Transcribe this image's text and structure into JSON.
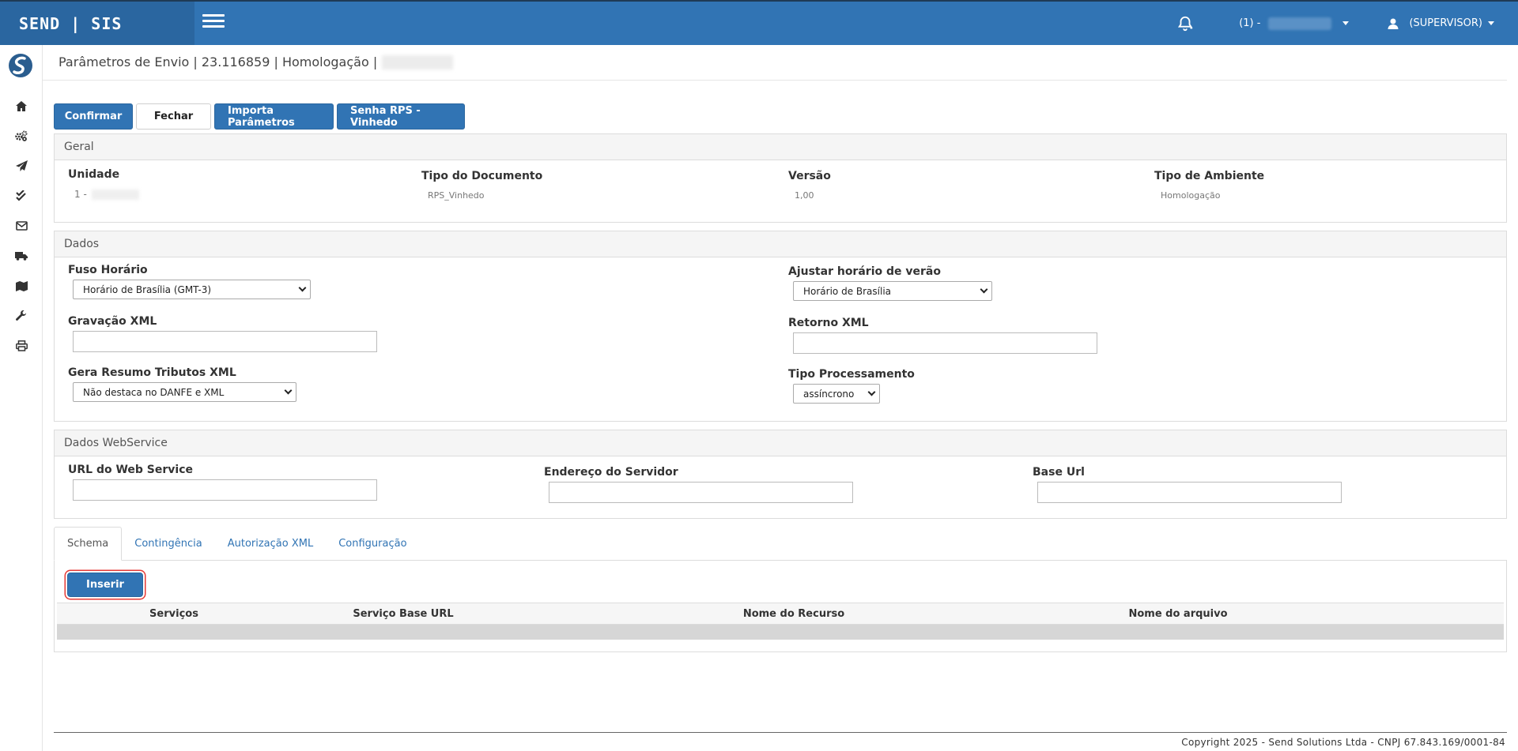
{
  "navbar": {
    "brand": "SEND | SIS",
    "company_label": "(1) -",
    "user_label": "(SUPERVISOR)"
  },
  "sidebar": {
    "items": [
      "home-icon",
      "cogs-icon",
      "paper-plane-icon",
      "check-double-icon",
      "envelope-icon",
      "truck-icon",
      "map-icon",
      "wrench-icon",
      "print-icon"
    ]
  },
  "page": {
    "title": "Parâmetros de Envio | 23.116859 | Homologação |"
  },
  "toolbar": {
    "confirm": "Confirmar",
    "close": "Fechar",
    "import": "Importa Parâmetros",
    "rps": "Senha RPS - Vinhedo"
  },
  "geral": {
    "heading": "Geral",
    "unidade_label": "Unidade",
    "unidade_value": "1 -",
    "tipo_doc_label": "Tipo do Documento",
    "tipo_doc_value": "RPS_Vinhedo",
    "versao_label": "Versão",
    "versao_value": "1,00",
    "ambiente_label": "Tipo de Ambiente",
    "ambiente_value": "Homologação"
  },
  "dados": {
    "heading": "Dados",
    "fuso_label": "Fuso Horário",
    "fuso_value": "Horário de Brasília (GMT-3)",
    "verao_label": "Ajustar horário de verão",
    "verao_value": "Horário de Brasília",
    "gravacao_label": "Gravação XML",
    "gravacao_value": "",
    "retorno_label": "Retorno XML",
    "retorno_value": "",
    "resumo_label": "Gera Resumo Tributos XML",
    "resumo_value": "Não destaca no DANFE e XML",
    "processamento_label": "Tipo Processamento",
    "processamento_value": "assíncrono"
  },
  "webservice": {
    "heading": "Dados WebService",
    "url_label": "URL do Web Service",
    "url_value": "",
    "servidor_label": "Endereço do Servidor",
    "servidor_value": "",
    "base_label": "Base Url",
    "base_value": ""
  },
  "tabs": [
    "Schema",
    "Contingência",
    "Autorização XML",
    "Configuração"
  ],
  "schema": {
    "insert": "Inserir",
    "columns": [
      "Serviços",
      "Serviço Base URL",
      "Nome do Recurso",
      "Nome do arquivo"
    ]
  },
  "footer": {
    "copyright": "Copyright 2025 - Send Solutions Ltda - CNPJ 67.843.169/0001-84"
  },
  "colors": {
    "primary": "#3174b4",
    "brand_bg": "#2a66a0",
    "highlight_ring": "#e53935"
  }
}
